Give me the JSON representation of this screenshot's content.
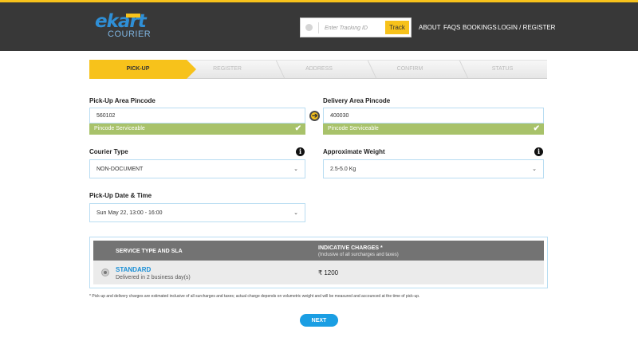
{
  "brand": {
    "name": "ekart",
    "sub": "COURIER",
    "colors": {
      "accent": "#f7c21b",
      "blue": "#1a9ee3",
      "header": "#383838",
      "ok": "#a8c26a"
    }
  },
  "header": {
    "track_placeholder": "Enter Tracking ID",
    "track_button": "Track",
    "nav": [
      "ABOUT",
      "FAQS",
      "BOOKINGS",
      "LOGIN / REGISTER"
    ]
  },
  "steps": [
    "PICK-UP",
    "REGISTER",
    "ADDRESS",
    "CONFIRM",
    "STATUS"
  ],
  "form": {
    "pickup_pincode": {
      "label": "Pick-Up Area Pincode",
      "value": "560102",
      "status": "Pincode Serviceable"
    },
    "delivery_pincode": {
      "label": "Delivery Area Pincode",
      "value": "400030",
      "status": "Pincode Serviceable"
    },
    "courier_type": {
      "label": "Courier Type",
      "value": "NON-DOCUMENT"
    },
    "weight": {
      "label": "Approximate Weight",
      "value": "2.5-5.0 Kg"
    },
    "pickup_datetime": {
      "label": "Pick-Up Date & Time",
      "value": "Sun May 22, 13:00 - 16:00"
    }
  },
  "service": {
    "col1": "SERVICE TYPE AND SLA",
    "col2": "INDICATIVE CHARGES *",
    "col2_sub": "(Inclusive of all surcharges and taxes)",
    "row": {
      "name": "STANDARD",
      "sla": "Delivered in 2 business day(s)",
      "price": "₹ 1200"
    }
  },
  "note": "* Pick-up and delivery charges are estimated inclusive of all surcharges and taxes; actual charge depends on volumetric weight and will be measured and accounced at the time of pick-up.",
  "next_button": "NEXT"
}
